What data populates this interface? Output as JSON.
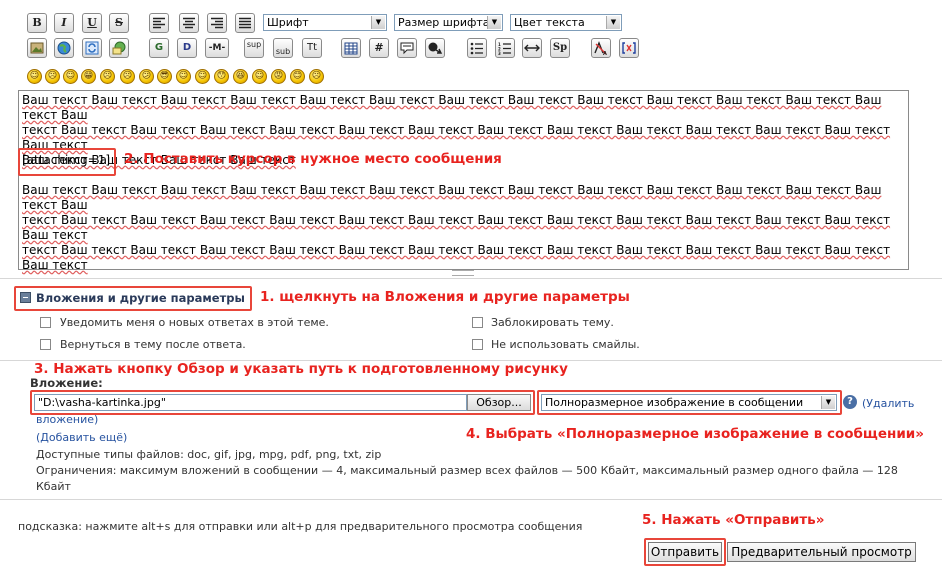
{
  "toolbar": {
    "row1": [
      "B",
      "I",
      "U",
      "S"
    ],
    "align_icons": [
      "align-left-icon",
      "align-center-icon",
      "align-right-icon",
      "align-justify-icon"
    ],
    "font_select": "Шрифт",
    "size_select": "Размер шрифта",
    "color_select": "Цвет текста",
    "row2": {
      "g": "G",
      "d": "D",
      "m": "-M-",
      "sup": "sup",
      "sub": "sub",
      "tt": "Tt",
      "hash": "#",
      "sp": "Sp"
    },
    "smileys": [
      "☺",
      "☹",
      "☺",
      "😁",
      "☹",
      "☹",
      "😕",
      "😎",
      "☺",
      "☺",
      "😯",
      "😆",
      "☺",
      "😡",
      "😊",
      "☹"
    ]
  },
  "editor": {
    "line1": "Ваш текст Ваш текст Ваш текст Ваш текст Ваш текст Ваш текст Ваш текст Ваш текст Ваш текст Ваш текст Ваш текст Ваш текст Ваш текст Ваш",
    "line2": "текст Ваш текст Ваш текст Ваш текст Ваш текст Ваш текст Ваш текст Ваш текст Ваш текст Ваш текст Ваш текст Ваш текст Ваш текст Ваш текст",
    "line3": "Ваш текст Ваш текст Ваш текст Ваш текст",
    "attach_tag": "[attachimg=1]",
    "line4": "Ваш текст Ваш текст Ваш текст Ваш текст Ваш текст Ваш текст Ваш текст Ваш текст Ваш текст Ваш текст Ваш текст Ваш текст Ваш текст Ваш",
    "line5": "текст Ваш текст Ваш текст Ваш текст Ваш текст Ваш текст Ваш текст Ваш текст Ваш текст Ваш текст Ваш текст Ваш текст Ваш текст Ваш текст",
    "line6": "текст Ваш текст Ваш текст Ваш текст Ваш текст Ваш текст Ваш текст Ваш текст Ваш текст Ваш текст Ваш текст Ваш текст Ваш текст Ваш текст"
  },
  "annotations": {
    "step1": "1. щелкнуть на Вложения и другие параметры",
    "step2": "2. Поставить курсор в нужное место сообщения",
    "step3": "3. Нажать кнопку Обзор и указать путь к подготовленному рисунку",
    "step4": "4. Выбрать «Полноразмерное изображение в сообщении»",
    "step5": "5. Нажать «Отправить»"
  },
  "options": {
    "toggle_label": "Вложения и другие параметры",
    "notify": "Уведомить меня о новых ответах в этой теме.",
    "lock": "Заблокировать тему.",
    "return": "Вернуться в тему после ответа.",
    "no_smileys": "Не использовать смайлы."
  },
  "attachment": {
    "label": "Вложение:",
    "file_value": "\"D:\\vasha-kartinka.jpg\"",
    "browse_label": "Обзор...",
    "mode_value": "Полноразмерное изображение в сообщении",
    "remove_link": "(Удалить",
    "remove_link_cont": "вложение)",
    "add_more": "(Добавить ещё)",
    "allowed_types": "Доступные типы файлов: doc, gif, jpg, mpg, pdf, png, txt, zip",
    "limits_line1": "Ограничения: максимум вложений в сообщении — 4, максимальный размер всех файлов — 500 Кбайт, максимальный размер одного файла — 128",
    "limits_line2": "Кбайт"
  },
  "footer": {
    "hint": "подсказка: нажмите alt+s для отправки или alt+p для предварительного просмотра сообщения",
    "submit_label": "Отправить",
    "preview_label": "Предварительный просмотр"
  },
  "colors": {
    "annotation_red": "#e8231f",
    "link_blue": "#2753a0",
    "help_icon": "#4a6fa5"
  }
}
